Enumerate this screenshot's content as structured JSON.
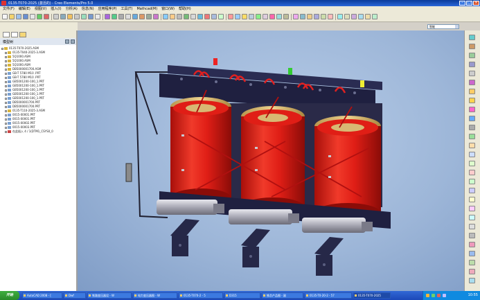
{
  "window": {
    "title": "0135-T070-2025 (激活的) - Creo Elements/Pro 5.0"
  },
  "menu": [
    "文件(F)",
    "编辑(E)",
    "视图(V)",
    "插入(I)",
    "分析(A)",
    "信息(N)",
    "应用程序(P)",
    "工具(T)",
    "Mathcad(M)",
    "窗口(W)",
    "帮助(H)"
  ],
  "selector": {
    "value": "智能"
  },
  "hint": "◆ 零件中的所有特征已再生。",
  "sidebar": {
    "panel_title": "模型树",
    "tree": [
      {
        "label": "0135-T070-2025.ASM",
        "level": 0,
        "color": "#d9b43a"
      },
      {
        "label": "0135-T040-2025-3.ASM",
        "level": 1,
        "color": "#d9b43a"
      },
      {
        "label": "5Q1000.ASM",
        "level": 1,
        "color": "#d9b43a"
      },
      {
        "label": "5Q1000.ASM",
        "level": 1,
        "color": "#d9b43a"
      },
      {
        "label": "5Q1000.ASM",
        "level": 1,
        "color": "#d9b43a"
      },
      {
        "label": "DB5000001700.ASM",
        "level": 1,
        "color": "#d9b43a"
      },
      {
        "label": "GB-T 5780 M10 .PRT",
        "level": 1,
        "color": "#7aa0d0"
      },
      {
        "label": "GB-T 5780 M10 .PRT",
        "level": 1,
        "color": "#7aa0d0"
      },
      {
        "label": "GB5001200-100_1.PRT",
        "level": 1,
        "color": "#7aa0d0"
      },
      {
        "label": "GB5001200-100_1.PRT",
        "level": 1,
        "color": "#7aa0d0"
      },
      {
        "label": "GB5001200-100_1.PRT",
        "level": 1,
        "color": "#7aa0d0"
      },
      {
        "label": "GB5001200-100_1.PRT",
        "level": 1,
        "color": "#7aa0d0"
      },
      {
        "label": "GB5001200-100_1.PRT",
        "level": 1,
        "color": "#7aa0d0"
      },
      {
        "label": "DB5000001700.PRT",
        "level": 1,
        "color": "#7aa0d0"
      },
      {
        "label": "DB5000001700.PRT",
        "level": 1,
        "color": "#7aa0d0"
      },
      {
        "label": "0135-T110-2025-3.ASM",
        "level": 1,
        "color": "#d9b43a"
      },
      {
        "label": "0015-00001.PRT",
        "level": 1,
        "color": "#7aa0d0"
      },
      {
        "label": "0015-00001.PRT",
        "level": 1,
        "color": "#7aa0d0"
      },
      {
        "label": "0015-00002.PRT",
        "level": 1,
        "color": "#7aa0d0"
      },
      {
        "label": "0015-00003.PRT",
        "level": 1,
        "color": "#7aa0d0"
      },
      {
        "label": "在此插入 4 / 1(DTM1_CSYS0_0",
        "level": 1,
        "color": "#c44"
      }
    ]
  },
  "taskbar": {
    "start": "开始",
    "tasks": [
      "AutoCAD 2008 - [",
      "Dwf",
      "铁路变压器设 - W",
      "电力变压器图 - W",
      "0135-T070-2 - 5",
      "D315",
      "铁芯产品图 - 副",
      "0135-T0-20-2 - 57",
      "0135-T070-2025"
    ],
    "active_task": 8,
    "clock": "10:55"
  },
  "colors": {
    "viewport_top": "#b8cde8",
    "coil_red": "#e01e16",
    "frame_dark": "#1e1e3c",
    "insulation_tan": "#d8b873"
  }
}
